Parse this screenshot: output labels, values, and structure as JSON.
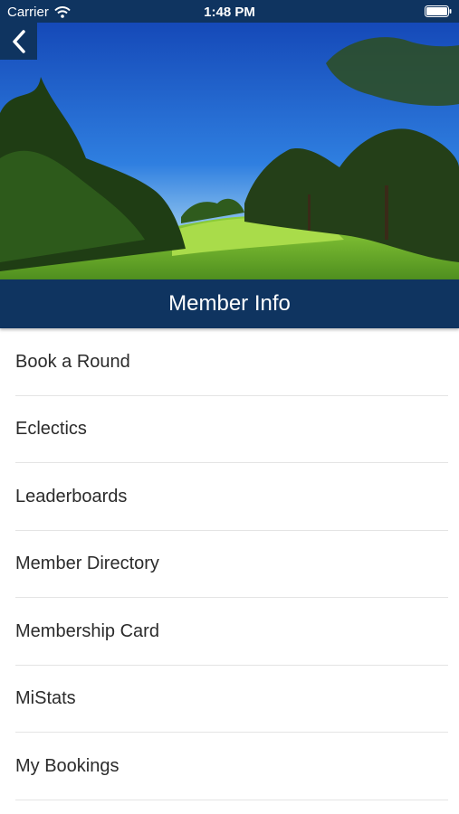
{
  "status_bar": {
    "carrier": "Carrier",
    "time": "1:48 PM",
    "wifi_icon": "wifi-icon",
    "battery_icon": "battery-icon"
  },
  "header": {
    "back_icon": "chevron-left-icon",
    "title": "Member Info",
    "hero_image": "golf-course-photo"
  },
  "menu": {
    "items": [
      {
        "label": "Book a Round"
      },
      {
        "label": "Eclectics"
      },
      {
        "label": "Leaderboards"
      },
      {
        "label": "Member Directory"
      },
      {
        "label": "Membership Card"
      },
      {
        "label": "MiStats"
      },
      {
        "label": "My Bookings"
      }
    ]
  },
  "colors": {
    "nav_background": "#0f3460",
    "text": "#2b2b2b",
    "divider": "#e4e4e4"
  }
}
